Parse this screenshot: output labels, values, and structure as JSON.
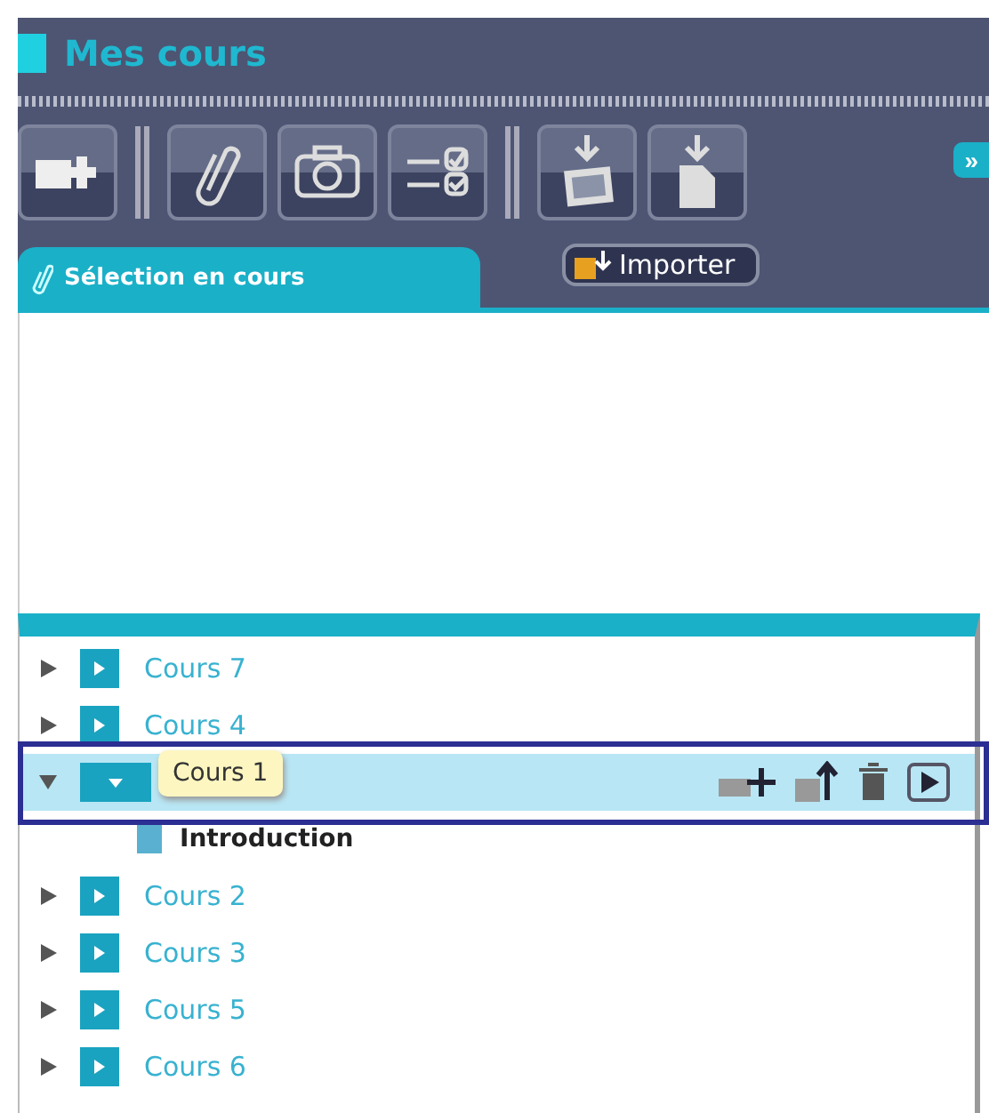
{
  "header": {
    "title": "Mes cours"
  },
  "toolbar": {
    "buttons": [
      {
        "kind": "add"
      },
      {
        "kind": "separator"
      },
      {
        "kind": "clip"
      },
      {
        "kind": "camera"
      },
      {
        "kind": "checklist"
      },
      {
        "kind": "separator"
      },
      {
        "kind": "import-image"
      },
      {
        "kind": "import-file"
      }
    ],
    "expand": "»"
  },
  "tabs": [
    {
      "label": "Sélection en cours",
      "selected": true
    }
  ],
  "import_button": {
    "label": "Importer"
  },
  "tree": [
    {
      "label": "Cours 7",
      "expanded": false,
      "selected": false
    },
    {
      "label": "Cours 4",
      "expanded": false,
      "selected": false
    },
    {
      "tooltip": "Cours 1",
      "expanded": true,
      "selected": true,
      "children": [
        {
          "label": "Introduction"
        }
      ]
    },
    {
      "label": "Cours 2",
      "expanded": false,
      "selected": false
    },
    {
      "label": "Cours 3",
      "expanded": false,
      "selected": false
    },
    {
      "label": "Cours 5",
      "expanded": false,
      "selected": false
    },
    {
      "label": "Cours 6",
      "expanded": false,
      "selected": false
    }
  ]
}
